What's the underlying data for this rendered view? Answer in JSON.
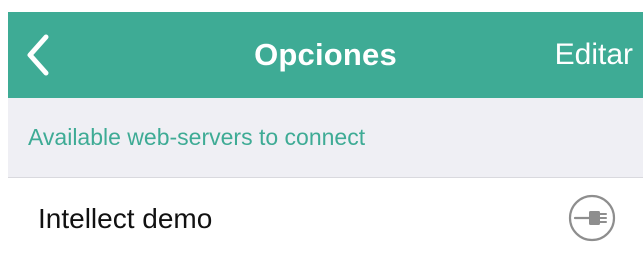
{
  "navbar": {
    "back_icon": "chevron-left-icon",
    "title": "Opciones",
    "edit_label": "Editar",
    "color": "#3eab95"
  },
  "section": {
    "header": "Available web-servers to connect",
    "header_color": "#3eab95",
    "background": "#efeff4"
  },
  "servers": [
    {
      "name": "Intellect demo",
      "icon": "plug-icon"
    }
  ]
}
